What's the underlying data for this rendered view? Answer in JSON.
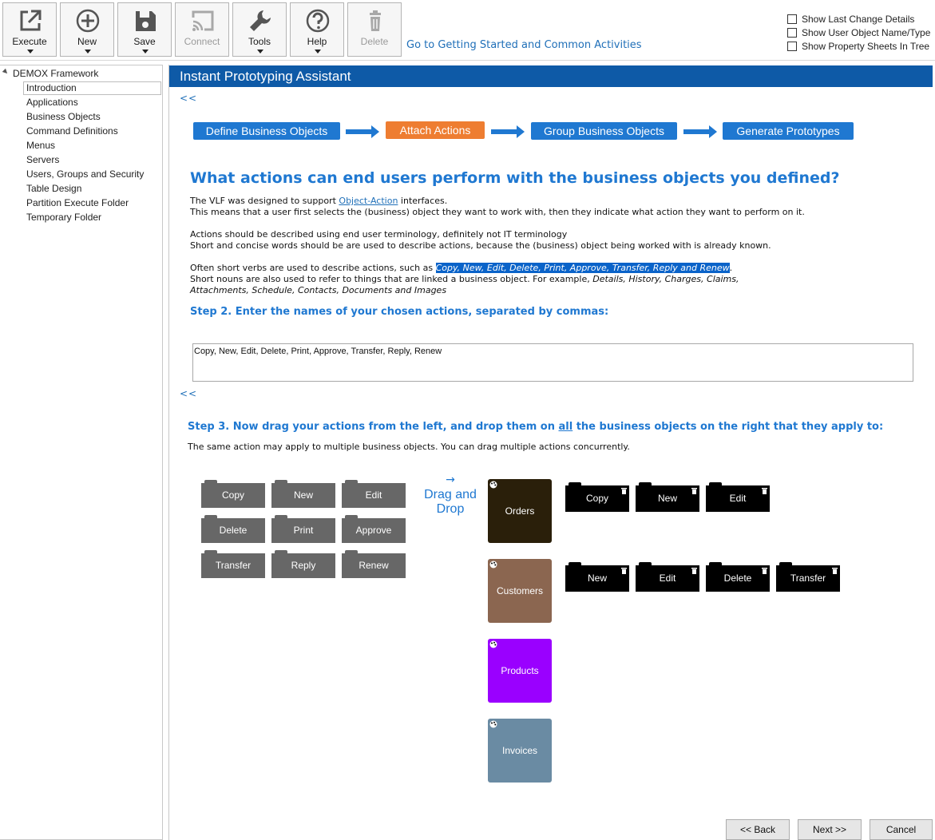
{
  "toolbar": {
    "buttons": [
      {
        "label": "Execute",
        "icon": "external-link-icon",
        "enabled": true
      },
      {
        "label": "New",
        "icon": "plus-circle-icon",
        "enabled": true
      },
      {
        "label": "Save",
        "icon": "floppy-disk-icon",
        "enabled": true
      },
      {
        "label": "Connect",
        "icon": "cast-icon",
        "enabled": false
      },
      {
        "label": "Tools",
        "icon": "wrench-icon",
        "enabled": true
      },
      {
        "label": "Help",
        "icon": "question-circle-icon",
        "enabled": true
      },
      {
        "label": "Delete",
        "icon": "trash-icon",
        "enabled": false
      }
    ],
    "getting_started_link": "Go to Getting Started and Common Activities",
    "options": [
      {
        "label": "Show Last Change Details",
        "checked": false
      },
      {
        "label": "Show User Object Name/Type",
        "checked": false
      },
      {
        "label": "Show Property Sheets In Tree",
        "checked": false
      }
    ]
  },
  "tree": {
    "root": "DEMOX Framework",
    "items": [
      {
        "label": "Introduction",
        "selected": true
      },
      {
        "label": "Applications"
      },
      {
        "label": "Business Objects"
      },
      {
        "label": "Command Definitions"
      },
      {
        "label": "Menus"
      },
      {
        "label": "Servers"
      },
      {
        "label": "Users, Groups and Security"
      },
      {
        "label": "Table Design"
      },
      {
        "label": "Partition Execute Folder"
      },
      {
        "label": "Temporary Folder"
      }
    ]
  },
  "main": {
    "banner": "Instant Prototyping Assistant",
    "back_link": "<<",
    "steps": [
      "Define Business Objects",
      "Attach Actions",
      "Group Business Objects",
      "Generate Prototypes"
    ],
    "active_step": "Attach Actions",
    "heading": "What actions can end users perform with the business objects you defined?",
    "p1_pre": "The VLF was designed to support ",
    "p1_link": "Object-Action",
    "p1_post": " interfaces.",
    "p2": "This means that a user first selects the (business) object they want to work with, then they indicate what action they want to perform on it.",
    "p3": "Actions should be described using end user terminology, definitely not IT terminology",
    "p4": "Short and concise words should be are used to describe actions, because the (business) object being worked with is already known.",
    "p5_pre": "Often short verbs are used to describe actions, such as ",
    "p5_highlight": "Copy, New, Edit, Delete, Print, Approve, Transfer, Reply and Renew",
    "p5_post": ".",
    "p6_pre": "Short nouns are also used to refer to things that are linked a business object. For example, ",
    "p6_italic": "Details, History, Charges, Claims,",
    "p7_italic": "Attachments, Schedule, Contacts, Documents and Images",
    "step2_heading": "Step 2. Enter the names of your chosen actions, separated by commas:",
    "actions_value": "Copy, New, Edit, Delete, Print, Approve, Transfer, Reply, Renew",
    "step3_pre": "Step 3. Now drag your actions from the left, and drop them on ",
    "step3_underline": "all",
    "step3_post": " the business objects on the right that they apply to:",
    "step3_note": "The same action may apply to multiple business objects. You can drag multiple actions concurrently.",
    "action_palette": [
      "Copy",
      "New",
      "Edit",
      "Delete",
      "Print",
      "Approve",
      "Transfer",
      "Reply",
      "Renew"
    ],
    "drag_arrow": "→",
    "drag_label_1": "Drag and",
    "drag_label_2": "Drop",
    "business_objects": [
      {
        "name": "Orders",
        "color": "#2a1f0a",
        "actions": [
          "Copy",
          "New",
          "Edit"
        ]
      },
      {
        "name": "Customers",
        "color": "#8b6650",
        "actions": [
          "New",
          "Edit",
          "Delete",
          "Transfer"
        ]
      },
      {
        "name": "Products",
        "color": "#9a00ff",
        "actions": []
      },
      {
        "name": "Invoices",
        "color": "#6a8ba3",
        "actions": []
      }
    ]
  },
  "footer": {
    "back": "<< Back",
    "next": "Next >>",
    "cancel": "Cancel"
  },
  "colors": {
    "banner": "#0e5aa7",
    "step_blue": "#1f78d1",
    "step_active": "#ee7d31",
    "heading": "#1f78d1"
  }
}
